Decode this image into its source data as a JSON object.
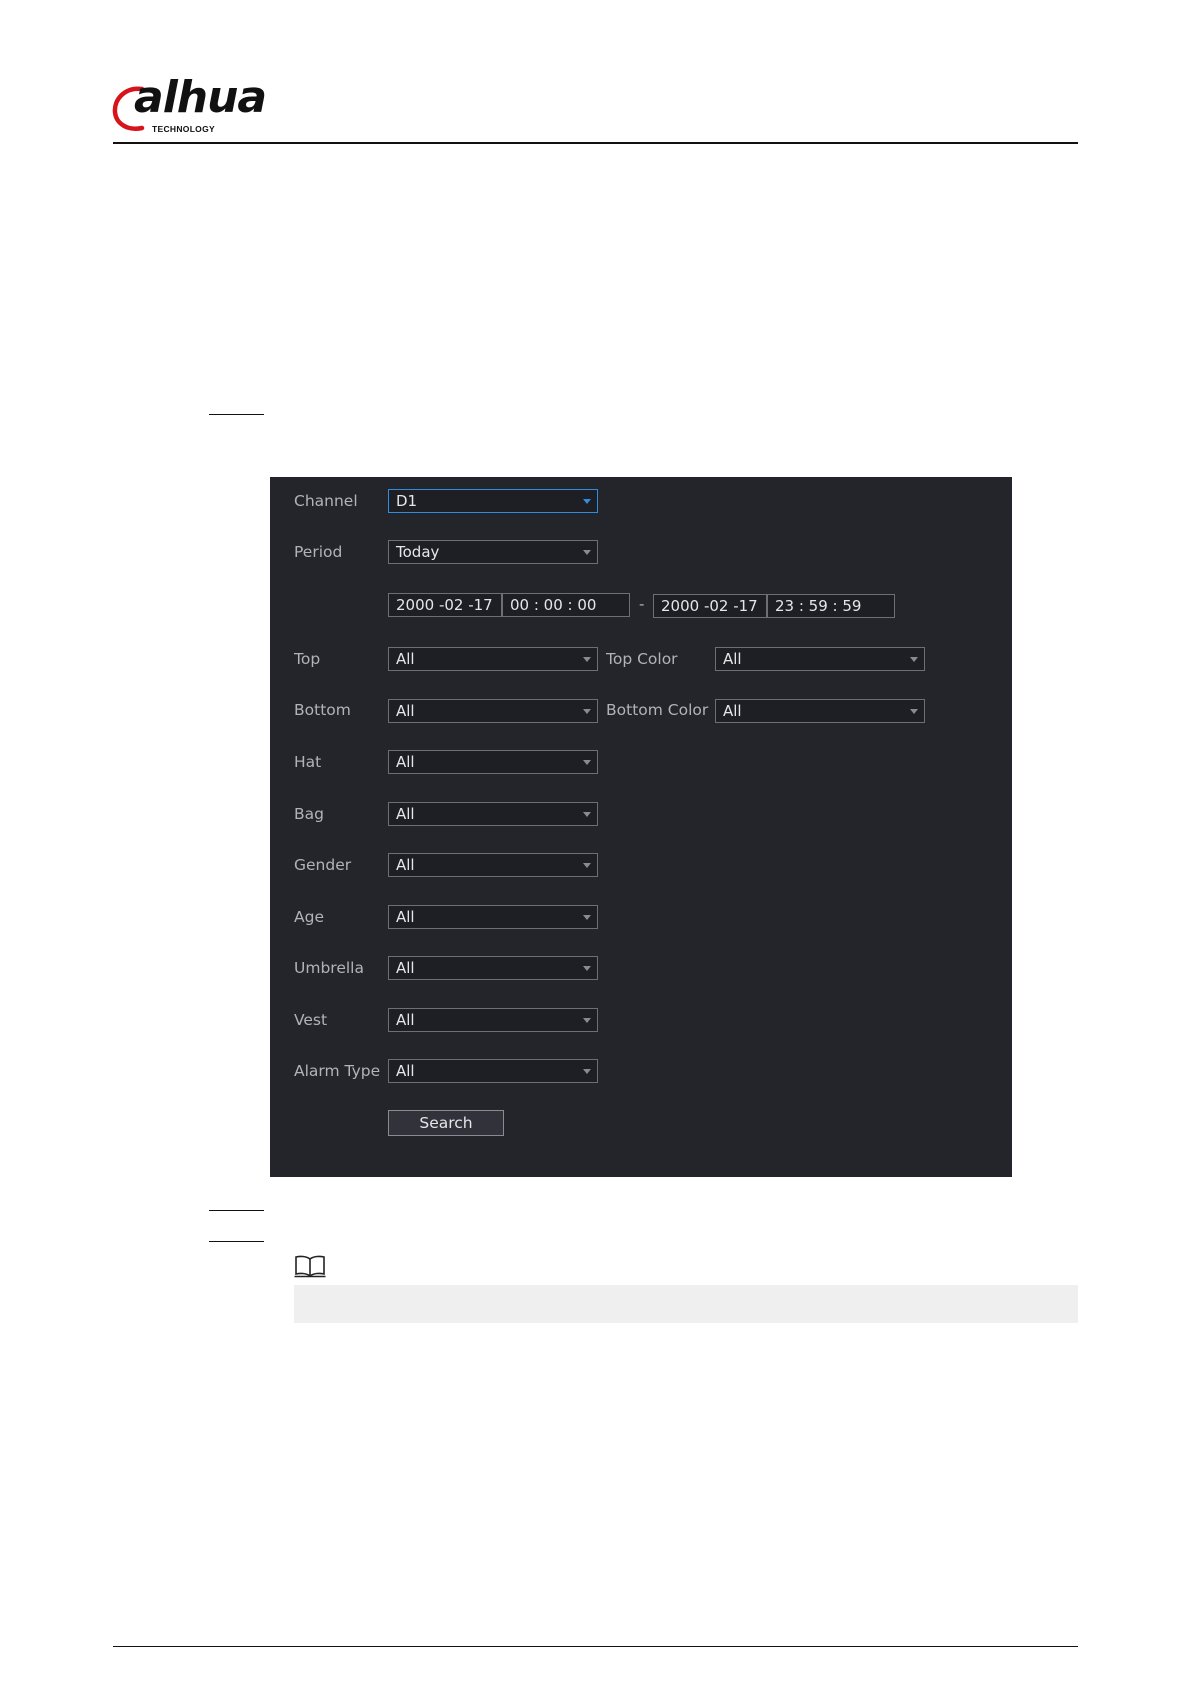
{
  "brand": {
    "name": "alhua",
    "tagline": "TECHNOLOGY",
    "accent_color": "#d7141a"
  },
  "form": {
    "channel": {
      "label": "Channel",
      "value": "D1"
    },
    "period": {
      "label": "Period",
      "value": "Today"
    },
    "time_range": {
      "start_date": "2000 -02 -17",
      "start_time": "00 : 00 : 00",
      "separator": "-",
      "end_date": "2000 -02 -17",
      "end_time": "23 : 59 : 59"
    },
    "top": {
      "label": "Top",
      "value": "All"
    },
    "top_color": {
      "label": "Top Color",
      "value": "All"
    },
    "bottom": {
      "label": "Bottom",
      "value": "All"
    },
    "bottom_color": {
      "label": "Bottom Color",
      "value": "All"
    },
    "hat": {
      "label": "Hat",
      "value": "All"
    },
    "bag": {
      "label": "Bag",
      "value": "All"
    },
    "gender": {
      "label": "Gender",
      "value": "All"
    },
    "age": {
      "label": "Age",
      "value": "All"
    },
    "umbrella": {
      "label": "Umbrella",
      "value": "All"
    },
    "vest": {
      "label": "Vest",
      "value": "All"
    },
    "alarm_type": {
      "label": "Alarm Type",
      "value": "All"
    },
    "search_label": "Search"
  }
}
